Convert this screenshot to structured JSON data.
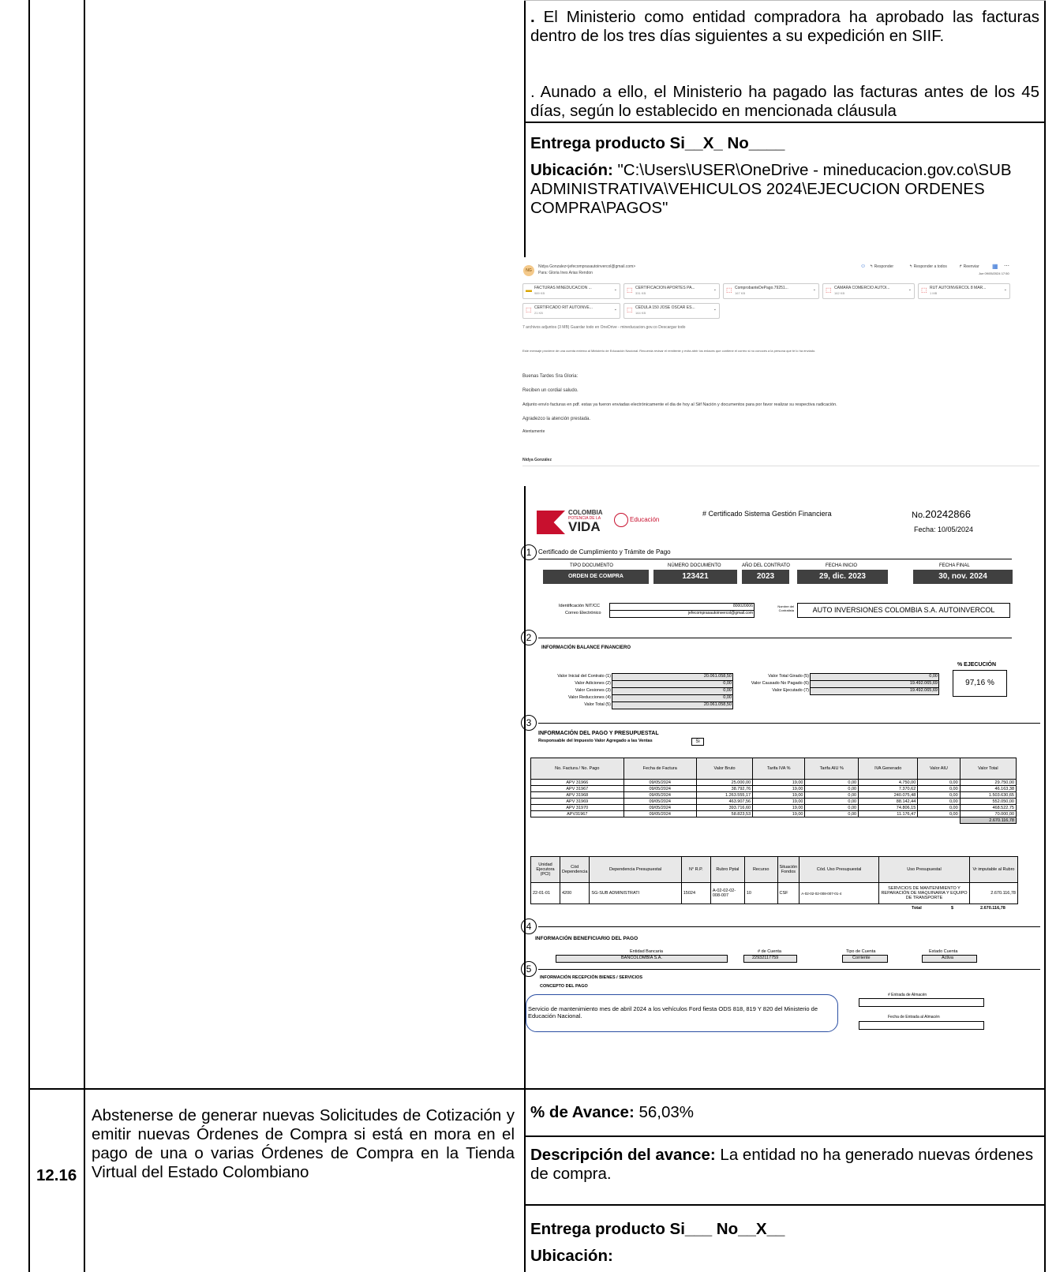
{
  "row_prev": {
    "para1_dot": ".",
    "para1_text": " El Ministerio como entidad compradora ha aprobado las facturas dentro de los tres días siguientes a su expedición en SIIF.",
    "para2_text": ". Aunado a ello, el Ministerio ha pagado las facturas antes de los 45 días, según lo establecido en mencionada cláusula",
    "entrega_label": "Entrega producto Si__X_ No____",
    "ubicacion_label": "Ubicación:",
    "ubicacion_value": " \"C:\\Users\\USER\\OneDrive - mineducacion.gov.co\\SUB ADMINISTRATIVA\\VEHICULOS 2024\\EJECUCION ORDENES COMPRA\\PAGOS\""
  },
  "email": {
    "avatar": "NG",
    "from": "Nidya Gonzalez<jefecomprasautoinvercol@gmail.com>",
    "to": "Para: Gloria Ines Arias Rendon",
    "actions": [
      "Responder",
      "Responder a todos",
      "Reenviar"
    ],
    "date": "Jue 09/05/2024 17:50",
    "attachments": [
      {
        "name": "FACTURAS MINEDUCACION ...",
        "size": "989 KB"
      },
      {
        "name": "CERTIFICACION APORTES PA...",
        "size": "331 KB"
      },
      {
        "name": "ComprobanteDePago.79251...",
        "size": "167 KB"
      },
      {
        "name": "CAMARA COMERCIO AUTOI...",
        "size": "162 KB"
      },
      {
        "name": "RUT AUTOINVERCOL 8 MAR...",
        "size": "1 MB"
      },
      {
        "name": "CERTIFICADO RIT AUTOINVE...",
        "size": "21 KB"
      },
      {
        "name": "CEDULA 150 JOSE OSCAR ES...",
        "size": "164 KB"
      }
    ],
    "attach_summary": "7 archivos adjuntos (3 MB)   Guardar todo en OneDrive - mineducacion.gov.co   Descargar todo",
    "warning": "Este mensaje proviene de una cuenta externa al Ministerio de Educación Nacional. Recuerda revisar el remitente y evita abrir los enlaces que contiene el correo si no conoces a la persona que te lo ha enviado.",
    "body": [
      "Buenas Tardes Sra Gloria:",
      "Reciben un cordial saludo.",
      "Adjunto envío facturas en pdf. estas ya fueron enviadas electrónicamente el dia de hoy al Siif Nación y documentos para por favor realizar su respectiva radicación.",
      "Agradezco la atención prestada.",
      "Atentamente"
    ],
    "signature": "Nidya González"
  },
  "cert": {
    "logo_colombia": "COLOMBIA",
    "logo_potencia": "POTENCIA DE LA",
    "logo_vida": "VIDA",
    "logo_educacion": "Educación",
    "title": "# Certificado Sistema Gestión Financiera",
    "no_label": "No.",
    "no_value": "20242866",
    "fecha": "Fecha: 10/05/2024",
    "s1_num": "1",
    "s1_title": "Certificado de Cumplimiento y  Trámite de Pago",
    "col_headers": [
      "TIPO DOCUMENTO",
      "NÚMERO DOCUMENTO",
      "AÑO DEL CONTRATO",
      "FECHA INICIO",
      "FECHA FINAL"
    ],
    "col_values": [
      "ORDEN DE COMPRA",
      "123421",
      "2023",
      "29, dic. 2023",
      "30, nov. 2024"
    ],
    "nit_label": "Identificación NIT/CC",
    "nit_value": "800020006",
    "correo_label": "Correo Electrónico",
    "correo_value": "jefecomprasautoinvercol@gmail.com",
    "contratista_label": "Nombre del Contratista",
    "contratista_value": "AUTO INVERSIONES COLOMBIA S.A. AUTOINVERCOL",
    "s2_num": "2",
    "s2_title": "INFORMACIÓN BALANCE FINANCIERO",
    "ejec_label": "% EJECUCIÓN",
    "ejec_value": "97,16  %",
    "bal_left": [
      {
        "label": "Valor Inicial del Contrato (1)",
        "value": "20.061.058,50"
      },
      {
        "label": "Valor Adiciones (2)",
        "value": "0,00"
      },
      {
        "label": "Valor Cesiones (3)",
        "value": "0,00"
      },
      {
        "label": "Valor Reducciones (4)",
        "value": "0,00"
      },
      {
        "label": "Valor Total (5)",
        "value": "20.061.058,50"
      }
    ],
    "bal_right": [
      {
        "label": "Valor Total Girado (5)",
        "value": "0,00"
      },
      {
        "label": "Valor Causado No Pagado (6)",
        "value": "19.492.065,69"
      },
      {
        "label": "Valor Ejecutado (7)",
        "value": "19.492.065,69"
      }
    ],
    "s3_num": "3",
    "s3_title": "INFORMACIÓN DEL PAGO Y PRESUPUESTAL",
    "iva_label": "Responsable del Impuesto Valor Agregado a las Ventas",
    "iva_value": "Si",
    "inv_headers": [
      "No. Factura / No. Pago",
      "Fecha de Factura",
      "Valor Bruto",
      "Tarifa IVA %",
      "Tarifa AIU %",
      "IVA Generado",
      "Valor AIU",
      "Valor Total"
    ],
    "inv_rows": [
      [
        "APV 31966",
        "09/05/2024",
        "25.000,00",
        "19,00",
        "0,00",
        "4.750,00",
        "0,00",
        "29.750,00"
      ],
      [
        "APV 31967",
        "09/05/2024",
        "38.792,76",
        "19,00",
        "0,00",
        "7.370,62",
        "0,00",
        "46.163,38"
      ],
      [
        "APV 31968",
        "09/05/2024",
        "1.263.555,17",
        "19,00",
        "0,00",
        "240.075,48",
        "0,00",
        "1.503.630,65"
      ],
      [
        "APV 31969",
        "09/05/2024",
        "463.907,56",
        "19,00",
        "0,00",
        "88.142,44",
        "0,00",
        "552.050,00"
      ],
      [
        "APV 31970",
        "09/05/2024",
        "393.716,60",
        "19,00",
        "0,00",
        "74.806,15",
        "0,00",
        "468.522,75"
      ],
      [
        "APV31967",
        "09/05/2024",
        "58.823,53",
        "19,00",
        "0,00",
        "11.176,47",
        "0,00",
        "70.000,00"
      ]
    ],
    "inv_total": "2.670.116,78",
    "pres_headers": [
      "Unidad Ejecutora (PCI)",
      "Cód Dependencia",
      "Dependencia Presupuestal",
      "N° R.P.",
      "Rubro Pptal",
      "Recurso",
      "Situación Fondos",
      "Cód. Uso Presupuestal",
      "Uso Presupuestal",
      "Vr imputable al Rubro"
    ],
    "pres_row": [
      "22-01-01",
      "4200",
      "SG-SUB ADMINISTRATI",
      "15024",
      "A-02-02-02-008-007",
      "10",
      "CSF",
      "A-02-02-02-008-007-01-4",
      "SERVICIOS DE MANTENIMIENTO Y REPARACIÓN DE MAQUINARIA Y EQUIPO DE TRANSPORTE",
      "2.670.116,78"
    ],
    "pres_total_label": "Total",
    "pres_total_currency": "$",
    "pres_total_value": "2.670.116,78",
    "s4_num": "4",
    "s4_title": "INFORMACIÓN BENEFICIARIO DEL PAGO",
    "ben_headers": [
      "Entidad Bancaria",
      "# de Cuenta",
      "Tipo de Cuenta",
      "Estado Cuenta"
    ],
    "ben_values": [
      "BANCOLOMBIA S.A.",
      "22932117759",
      "Corriente",
      "Activa"
    ],
    "s5_num": "5",
    "s5_title": "INFORMACIÓN RECEPCIÓN BIENES / SERVICIOS",
    "concepto_label": "CONCEPTO DEL PAGO",
    "concepto_text": "Servicio de mantenimiento mes de abril 2024 a los vehículos Ford fiesta ODS 818, 819 Y 820 del Ministerio de Educación Nacional.",
    "entrada_label": "# Entrada de Almacén",
    "fecha_entrada_label": "Fecha de Entrada al Almacén"
  },
  "row_1216": {
    "number": "12.16",
    "description": "Abstenerse de generar nuevas Solicitudes de Cotización y emitir nuevas Órdenes de Compra si está en mora en el pago de una o varias Órdenes de Compra en la Tienda Virtual del Estado Colombiano",
    "avance_label": "% de Avance:",
    "avance_value": " 56,03%",
    "desc_label": "Descripción del avance:",
    "desc_value": " La entidad no ha generado nuevas órdenes de compra.",
    "entrega_label": "Entrega producto Si___ No__X__",
    "ubicacion_label": "Ubicación:"
  }
}
